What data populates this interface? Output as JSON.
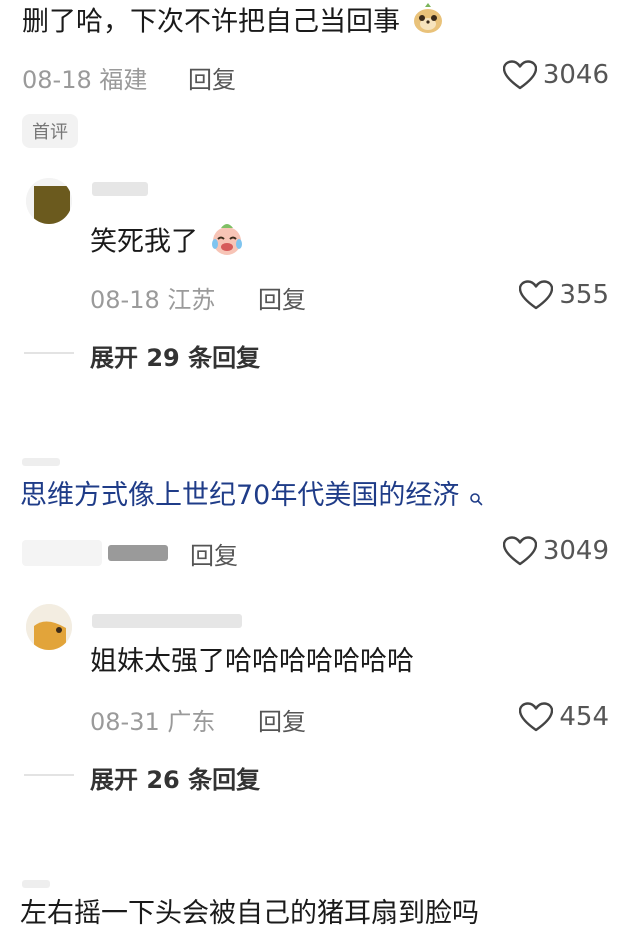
{
  "comment1": {
    "text": "删了哈，下次不许把自己当回事",
    "meta": "08-18 福建",
    "reply_label": "回复",
    "likes": "3046",
    "tag": "首评"
  },
  "reply1": {
    "text": "笑死我了",
    "meta": "08-18 江苏",
    "reply_label": "回复",
    "likes": "355"
  },
  "expand1": {
    "label": "展开 29 条回复"
  },
  "comment2": {
    "text": "思维方式像上世纪70年代美国的经济",
    "search_hint_icon": "search-icon",
    "reply_label": "回复",
    "likes": "3049"
  },
  "reply2": {
    "text": "姐妹太强了哈哈哈哈哈哈哈",
    "meta": "08-31 广东",
    "reply_label": "回复",
    "likes": "454"
  },
  "expand2": {
    "label": "展开 26 条回复"
  },
  "comment3": {
    "text": "左右摇一下头会被自己的猪耳扇到脸吗"
  },
  "colors": {
    "link_text": "#1f3c88",
    "meta_gray": "#9a9a9a",
    "text_dark": "#1a1a1a"
  }
}
